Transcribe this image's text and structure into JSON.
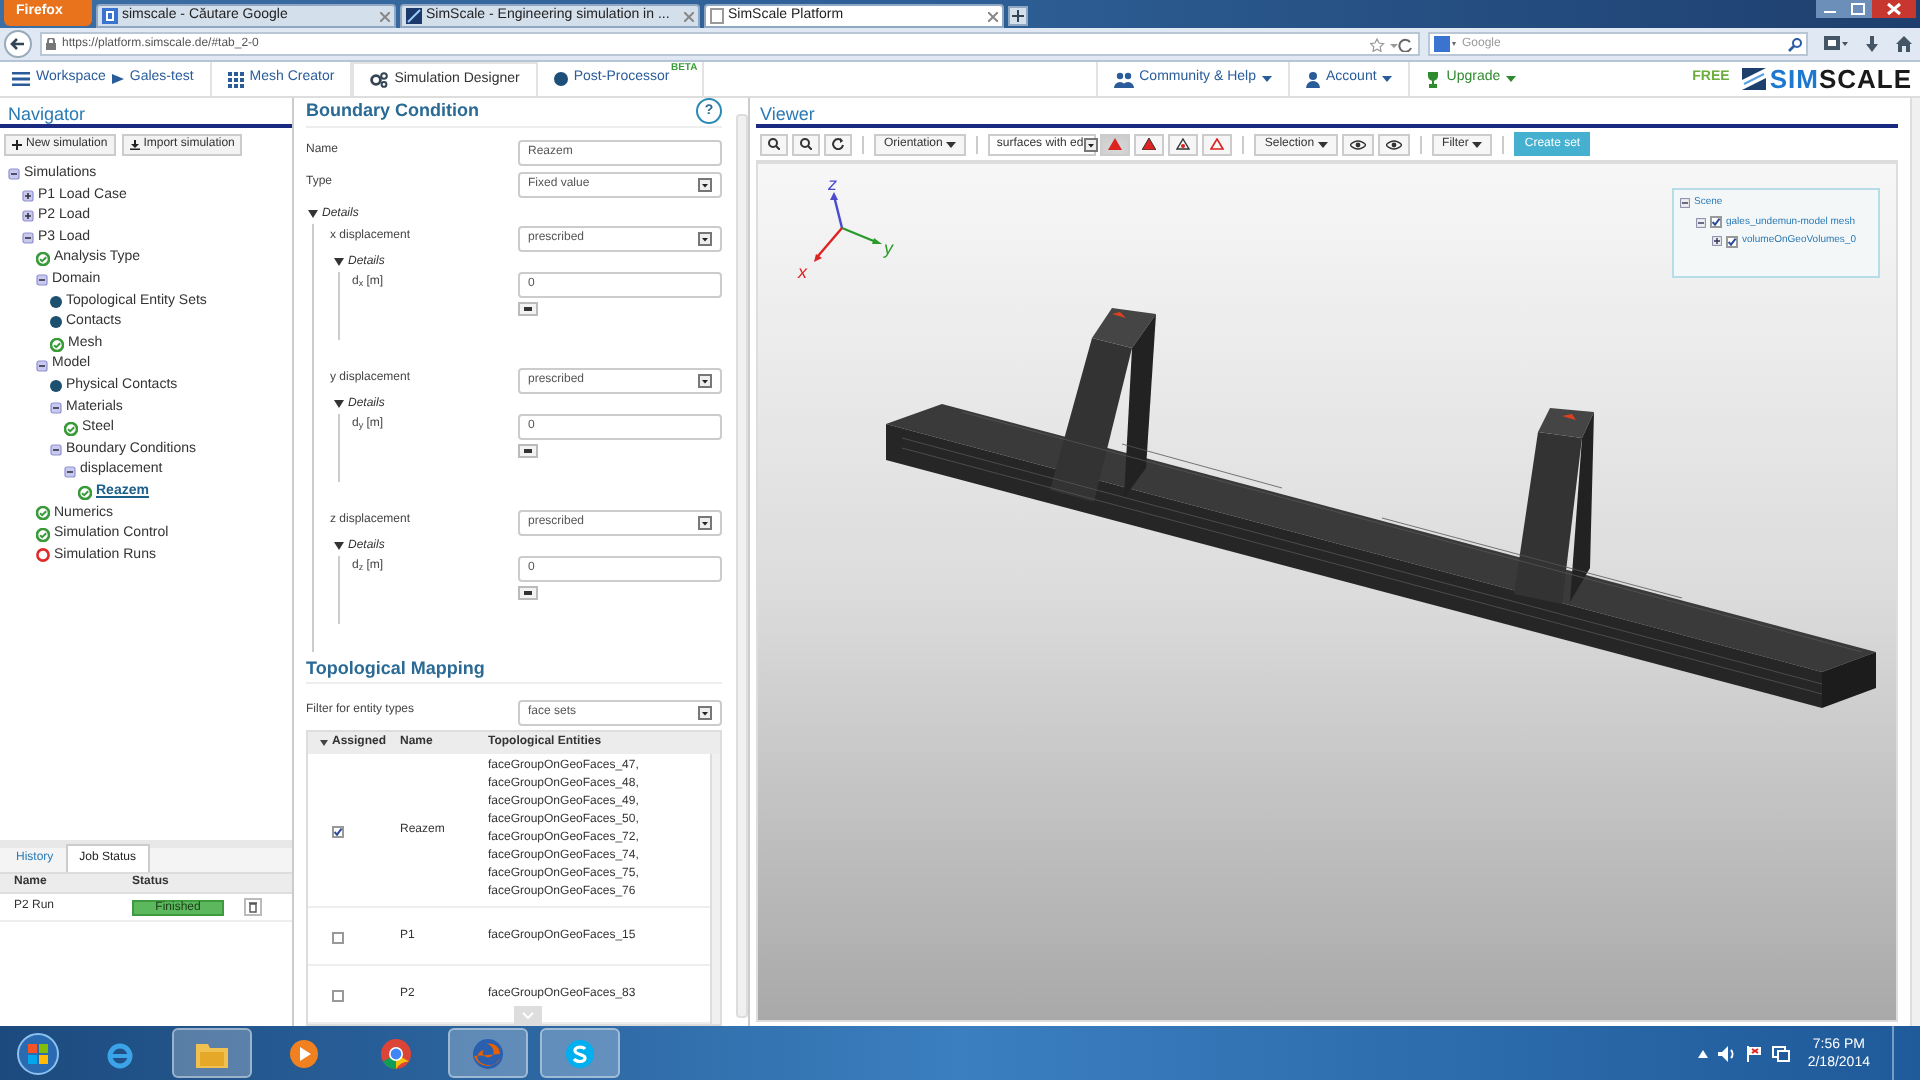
{
  "browser": {
    "menu_button": "Firefox",
    "tabs": [
      {
        "title": "simscale - Căutare Google",
        "selected": false
      },
      {
        "title": "SimScale - Engineering simulation in ...",
        "selected": false
      },
      {
        "title": "SimScale Platform",
        "selected": true
      }
    ],
    "url": "https://platform.simscale.de/#tab_2-0",
    "search_placeholder": "Google"
  },
  "app_nav": {
    "breadcrumb": [
      "Workspace",
      "Gales-test"
    ],
    "items": [
      {
        "label": "Mesh Creator",
        "selected": false
      },
      {
        "label": "Simulation Designer",
        "selected": true
      },
      {
        "label": "Post-Processor",
        "badge": "BETA",
        "selected": false
      }
    ],
    "menus": [
      {
        "label": "Community & Help"
      },
      {
        "label": "Account"
      },
      {
        "label": "Upgrade"
      }
    ],
    "plan": "FREE",
    "logo": {
      "first": "SIM",
      "second": "SCALE"
    }
  },
  "navigator": {
    "title": "Navigator",
    "buttons": [
      "New simulation",
      "Import simulation"
    ],
    "tree": [
      {
        "label": "Simulations",
        "kind": "group",
        "expanded": true,
        "selected": false,
        "children": [
          {
            "label": "P1 Load Case",
            "kind": "group",
            "expanded": false,
            "selected": false
          },
          {
            "label": "P2 Load",
            "kind": "group",
            "expanded": false,
            "selected": false
          },
          {
            "label": "P3 Load",
            "kind": "group",
            "expanded": true,
            "selected": false,
            "children": [
              {
                "label": "Analysis Type",
                "kind": "ok",
                "selected": false
              },
              {
                "label": "Domain",
                "kind": "group",
                "expanded": true,
                "selected": false,
                "children": [
                  {
                    "label": "Topological Entity Sets",
                    "kind": "pending",
                    "selected": false
                  },
                  {
                    "label": "Contacts",
                    "kind": "pending",
                    "selected": false
                  },
                  {
                    "label": "Mesh",
                    "kind": "ok",
                    "selected": false
                  }
                ]
              },
              {
                "label": "Model",
                "kind": "group",
                "expanded": true,
                "selected": false,
                "children": [
                  {
                    "label": "Physical Contacts",
                    "kind": "pending",
                    "selected": false
                  },
                  {
                    "label": "Materials",
                    "kind": "group",
                    "expanded": true,
                    "selected": false,
                    "children": [
                      {
                        "label": "Steel",
                        "kind": "ok",
                        "selected": false
                      }
                    ]
                  },
                  {
                    "label": "Boundary Conditions",
                    "kind": "group",
                    "expanded": true,
                    "selected": false,
                    "children": [
                      {
                        "label": "displacement",
                        "kind": "group",
                        "expanded": true,
                        "selected": false,
                        "children": [
                          {
                            "label": "Reazem",
                            "kind": "ok",
                            "selected": true
                          }
                        ]
                      }
                    ]
                  }
                ]
              },
              {
                "label": "Numerics",
                "kind": "ok",
                "selected": false
              },
              {
                "label": "Simulation Control",
                "kind": "ok",
                "selected": false
              },
              {
                "label": "Simulation Runs",
                "kind": "error",
                "selected": false
              }
            ]
          }
        ]
      }
    ],
    "bottom_tabs": [
      {
        "label": "History",
        "selected": false
      },
      {
        "label": "Job Status",
        "selected": true
      }
    ],
    "jobs": {
      "columns": [
        "Name",
        "Status"
      ],
      "rows": [
        {
          "name": "P2 Run",
          "status": "Finished"
        }
      ]
    }
  },
  "boundary_condition": {
    "title": "Boundary Condition",
    "help": "?",
    "fields": [
      {
        "label": "Name",
        "kind": "input",
        "value": "Reazem"
      },
      {
        "label": "Type",
        "kind": "select",
        "value": "Fixed value"
      }
    ],
    "details_label": "Details",
    "displacements": [
      {
        "label": "x displacement",
        "value": "prescribed",
        "details_label": "Details",
        "component": "d$_{x}$ [m]",
        "component_value": "0"
      },
      {
        "label": "y displacement",
        "value": "prescribed",
        "details_label": "Details",
        "component": "d$_{y}$ [m]",
        "component_value": "0"
      },
      {
        "label": "z displacement",
        "value": "prescribed",
        "details_label": "Details",
        "component": "d$_{z}$ [m]",
        "component_value": "0"
      }
    ]
  },
  "topological_mapping": {
    "title": "Topological Mapping",
    "filter_label": "Filter for entity types",
    "filter_value": "face sets",
    "columns": [
      "Assigned",
      "Name",
      "Topological Entities"
    ],
    "rows": [
      {
        "checked": true,
        "name": "Reazem",
        "entities": [
          "faceGroupOnGeoFaces_47,",
          "faceGroupOnGeoFaces_48,",
          "faceGroupOnGeoFaces_49,",
          "faceGroupOnGeoFaces_50,",
          "faceGroupOnGeoFaces_72,",
          "faceGroupOnGeoFaces_74,",
          "faceGroupOnGeoFaces_75,",
          "faceGroupOnGeoFaces_76"
        ]
      },
      {
        "checked": false,
        "name": "P1",
        "entities": [
          "faceGroupOnGeoFaces_15"
        ]
      },
      {
        "checked": false,
        "name": "P2",
        "entities": [
          "faceGroupOnGeoFaces_83"
        ]
      }
    ]
  },
  "viewer": {
    "title": "Viewer",
    "orientation": "Orientation",
    "display_mode": "surfaces with ed",
    "render_modes": [
      {
        "selected": true
      },
      {
        "selected": false
      },
      {
        "selected": false
      },
      {
        "selected": false
      }
    ],
    "selection": "Selection",
    "filter": "Filter",
    "create_set": "Create set",
    "axes": {
      "x": "x",
      "y": "y",
      "z": "z"
    },
    "scene": {
      "label": "Scene",
      "expanded": true,
      "children": [
        {
          "label": "gales_undemun-model mesh",
          "checked": true,
          "expanded": true,
          "children": [
            {
              "label": "volumeOnGeoVolumes_0",
              "checked": true,
              "expanded": false
            }
          ]
        }
      ]
    }
  },
  "taskbar": {
    "apps": [
      {
        "kind": "ie",
        "running": false
      },
      {
        "kind": "explorer",
        "running": true
      },
      {
        "kind": "media",
        "running": false
      },
      {
        "kind": "chrome",
        "running": false
      },
      {
        "kind": "firefox",
        "running": true
      },
      {
        "kind": "skype",
        "running": true
      }
    ],
    "time": "7:56 PM",
    "date": "2/18/2014"
  }
}
